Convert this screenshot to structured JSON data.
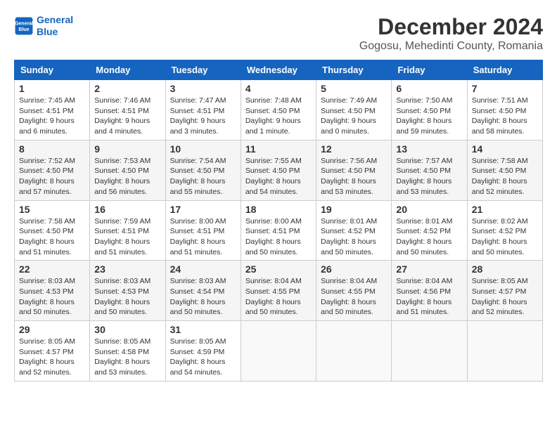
{
  "header": {
    "logo_line1": "General",
    "logo_line2": "Blue",
    "title": "December 2024",
    "subtitle": "Gogosu, Mehedinti County, Romania"
  },
  "columns": [
    "Sunday",
    "Monday",
    "Tuesday",
    "Wednesday",
    "Thursday",
    "Friday",
    "Saturday"
  ],
  "weeks": [
    [
      {
        "day": "1",
        "detail": "Sunrise: 7:45 AM\nSunset: 4:51 PM\nDaylight: 9 hours\nand 6 minutes."
      },
      {
        "day": "2",
        "detail": "Sunrise: 7:46 AM\nSunset: 4:51 PM\nDaylight: 9 hours\nand 4 minutes."
      },
      {
        "day": "3",
        "detail": "Sunrise: 7:47 AM\nSunset: 4:51 PM\nDaylight: 9 hours\nand 3 minutes."
      },
      {
        "day": "4",
        "detail": "Sunrise: 7:48 AM\nSunset: 4:50 PM\nDaylight: 9 hours\nand 1 minute."
      },
      {
        "day": "5",
        "detail": "Sunrise: 7:49 AM\nSunset: 4:50 PM\nDaylight: 9 hours\nand 0 minutes."
      },
      {
        "day": "6",
        "detail": "Sunrise: 7:50 AM\nSunset: 4:50 PM\nDaylight: 8 hours\nand 59 minutes."
      },
      {
        "day": "7",
        "detail": "Sunrise: 7:51 AM\nSunset: 4:50 PM\nDaylight: 8 hours\nand 58 minutes."
      }
    ],
    [
      {
        "day": "8",
        "detail": "Sunrise: 7:52 AM\nSunset: 4:50 PM\nDaylight: 8 hours\nand 57 minutes."
      },
      {
        "day": "9",
        "detail": "Sunrise: 7:53 AM\nSunset: 4:50 PM\nDaylight: 8 hours\nand 56 minutes."
      },
      {
        "day": "10",
        "detail": "Sunrise: 7:54 AM\nSunset: 4:50 PM\nDaylight: 8 hours\nand 55 minutes."
      },
      {
        "day": "11",
        "detail": "Sunrise: 7:55 AM\nSunset: 4:50 PM\nDaylight: 8 hours\nand 54 minutes."
      },
      {
        "day": "12",
        "detail": "Sunrise: 7:56 AM\nSunset: 4:50 PM\nDaylight: 8 hours\nand 53 minutes."
      },
      {
        "day": "13",
        "detail": "Sunrise: 7:57 AM\nSunset: 4:50 PM\nDaylight: 8 hours\nand 53 minutes."
      },
      {
        "day": "14",
        "detail": "Sunrise: 7:58 AM\nSunset: 4:50 PM\nDaylight: 8 hours\nand 52 minutes."
      }
    ],
    [
      {
        "day": "15",
        "detail": "Sunrise: 7:58 AM\nSunset: 4:50 PM\nDaylight: 8 hours\nand 51 minutes."
      },
      {
        "day": "16",
        "detail": "Sunrise: 7:59 AM\nSunset: 4:51 PM\nDaylight: 8 hours\nand 51 minutes."
      },
      {
        "day": "17",
        "detail": "Sunrise: 8:00 AM\nSunset: 4:51 PM\nDaylight: 8 hours\nand 51 minutes."
      },
      {
        "day": "18",
        "detail": "Sunrise: 8:00 AM\nSunset: 4:51 PM\nDaylight: 8 hours\nand 50 minutes."
      },
      {
        "day": "19",
        "detail": "Sunrise: 8:01 AM\nSunset: 4:52 PM\nDaylight: 8 hours\nand 50 minutes."
      },
      {
        "day": "20",
        "detail": "Sunrise: 8:01 AM\nSunset: 4:52 PM\nDaylight: 8 hours\nand 50 minutes."
      },
      {
        "day": "21",
        "detail": "Sunrise: 8:02 AM\nSunset: 4:52 PM\nDaylight: 8 hours\nand 50 minutes."
      }
    ],
    [
      {
        "day": "22",
        "detail": "Sunrise: 8:03 AM\nSunset: 4:53 PM\nDaylight: 8 hours\nand 50 minutes."
      },
      {
        "day": "23",
        "detail": "Sunrise: 8:03 AM\nSunset: 4:53 PM\nDaylight: 8 hours\nand 50 minutes."
      },
      {
        "day": "24",
        "detail": "Sunrise: 8:03 AM\nSunset: 4:54 PM\nDaylight: 8 hours\nand 50 minutes."
      },
      {
        "day": "25",
        "detail": "Sunrise: 8:04 AM\nSunset: 4:55 PM\nDaylight: 8 hours\nand 50 minutes."
      },
      {
        "day": "26",
        "detail": "Sunrise: 8:04 AM\nSunset: 4:55 PM\nDaylight: 8 hours\nand 50 minutes."
      },
      {
        "day": "27",
        "detail": "Sunrise: 8:04 AM\nSunset: 4:56 PM\nDaylight: 8 hours\nand 51 minutes."
      },
      {
        "day": "28",
        "detail": "Sunrise: 8:05 AM\nSunset: 4:57 PM\nDaylight: 8 hours\nand 52 minutes."
      }
    ],
    [
      {
        "day": "29",
        "detail": "Sunrise: 8:05 AM\nSunset: 4:57 PM\nDaylight: 8 hours\nand 52 minutes."
      },
      {
        "day": "30",
        "detail": "Sunrise: 8:05 AM\nSunset: 4:58 PM\nDaylight: 8 hours\nand 53 minutes."
      },
      {
        "day": "31",
        "detail": "Sunrise: 8:05 AM\nSunset: 4:59 PM\nDaylight: 8 hours\nand 54 minutes."
      },
      null,
      null,
      null,
      null
    ]
  ]
}
